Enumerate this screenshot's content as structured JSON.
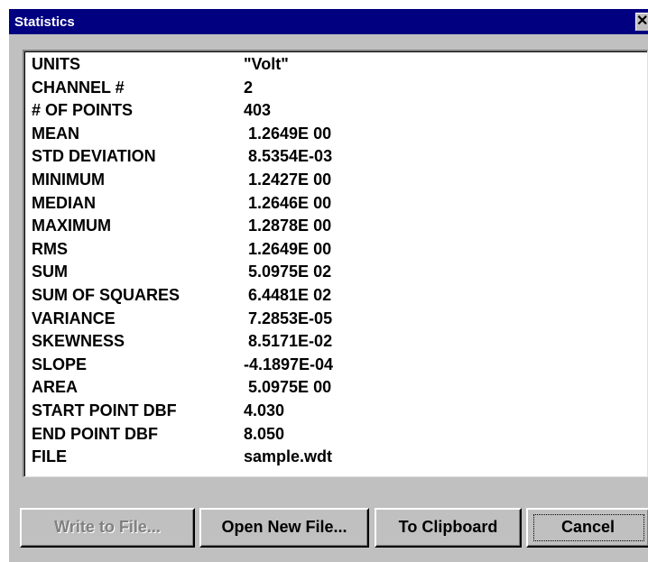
{
  "window": {
    "title": "Statistics",
    "close_label": "✕"
  },
  "stats": [
    {
      "label": "UNITS",
      "value": "\"Volt\""
    },
    {
      "label": "CHANNEL #",
      "value": "2"
    },
    {
      "label": "# OF POINTS",
      "value": "403"
    },
    {
      "label": "MEAN",
      "value": " 1.2649E 00"
    },
    {
      "label": "STD DEVIATION",
      "value": " 8.5354E-03"
    },
    {
      "label": "MINIMUM",
      "value": " 1.2427E 00"
    },
    {
      "label": "MEDIAN",
      "value": " 1.2646E 00"
    },
    {
      "label": "MAXIMUM",
      "value": " 1.2878E 00"
    },
    {
      "label": "RMS",
      "value": " 1.2649E 00"
    },
    {
      "label": "SUM",
      "value": " 5.0975E 02"
    },
    {
      "label": "SUM OF SQUARES",
      "value": " 6.4481E 02"
    },
    {
      "label": "VARIANCE",
      "value": " 7.2853E-05"
    },
    {
      "label": "SKEWNESS",
      "value": " 8.5171E-02"
    },
    {
      "label": "SLOPE",
      "value": "-4.1897E-04"
    },
    {
      "label": "AREA",
      "value": " 5.0975E 00"
    },
    {
      "label": "START POINT DBF",
      "value": "4.030"
    },
    {
      "label": "END POINT DBF",
      "value": "8.050"
    },
    {
      "label": "FILE",
      "value": "sample.wdt"
    }
  ],
  "buttons": {
    "write_to_file": "Write to File...",
    "open_new_file": "Open New File...",
    "to_clipboard": "To Clipboard",
    "cancel": "Cancel"
  }
}
